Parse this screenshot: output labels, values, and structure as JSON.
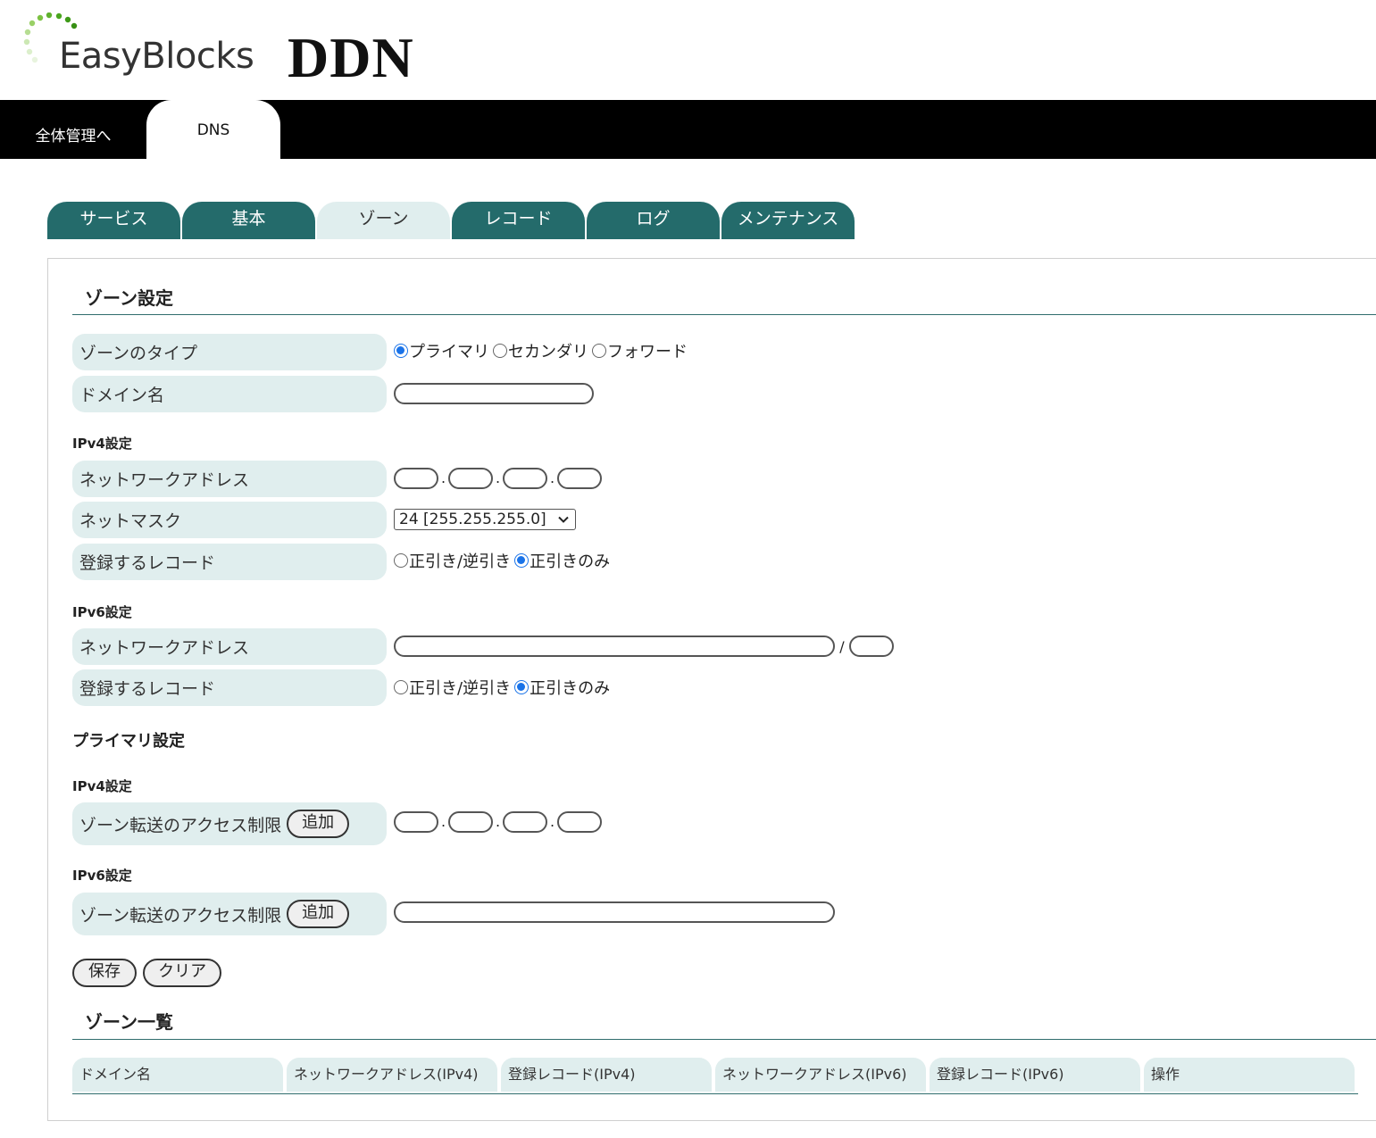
{
  "header": {
    "logo_text": "EasyBlocks",
    "brand": "DDN"
  },
  "top_tabs": [
    {
      "label": "全体管理へ"
    },
    {
      "label": "DNS"
    }
  ],
  "sub_tabs": [
    {
      "label": "サービス"
    },
    {
      "label": "基本"
    },
    {
      "label": "ゾーン"
    },
    {
      "label": "レコード"
    },
    {
      "label": "ログ"
    },
    {
      "label": "メンテナンス"
    }
  ],
  "active_sub_tab": "ゾーン",
  "zone_settings": {
    "title": "ゾーン設定",
    "zone_type": {
      "label": "ゾーンのタイプ",
      "options": [
        "プライマリ",
        "セカンダリ",
        "フォワード"
      ],
      "selected": "プライマリ"
    },
    "domain_name": {
      "label": "ドメイン名",
      "value": ""
    },
    "ipv4": {
      "heading": "IPv4設定",
      "network_address": {
        "label": "ネットワークアドレス",
        "octets": [
          "",
          "",
          "",
          ""
        ]
      },
      "netmask": {
        "label": "ネットマスク",
        "value": "24 [255.255.255.0]"
      },
      "register_record": {
        "label": "登録するレコード",
        "options": [
          "正引き/逆引き",
          "正引きのみ"
        ],
        "selected": "正引きのみ"
      }
    },
    "ipv6": {
      "heading": "IPv6設定",
      "network_address": {
        "label": "ネットワークアドレス",
        "value": "",
        "separator": "/",
        "prefix": ""
      },
      "register_record": {
        "label": "登録するレコード",
        "options": [
          "正引き/逆引き",
          "正引きのみ"
        ],
        "selected": "正引きのみ"
      }
    }
  },
  "primary_settings": {
    "heading": "プライマリ設定",
    "ipv4": {
      "heading": "IPv4設定",
      "label": "ゾーン転送のアクセス制限",
      "add_button": "追加",
      "octets": [
        "",
        "",
        "",
        ""
      ]
    },
    "ipv6": {
      "heading": "IPv6設定",
      "label": "ゾーン転送のアクセス制限",
      "add_button": "追加",
      "value": ""
    }
  },
  "actions": {
    "save": "保存",
    "clear": "クリア"
  },
  "zone_list": {
    "title": "ゾーン一覧",
    "columns": [
      "ドメイン名",
      "ネットワークアドレス(IPv4)",
      "登録レコード(IPv4)",
      "ネットワークアドレス(IPv6)",
      "登録レコード(IPv6)",
      "操作"
    ],
    "rows": []
  },
  "colors": {
    "teal": "#246b6b",
    "light_teal": "#e0eeee",
    "radio_selected": "#1a73e8"
  }
}
